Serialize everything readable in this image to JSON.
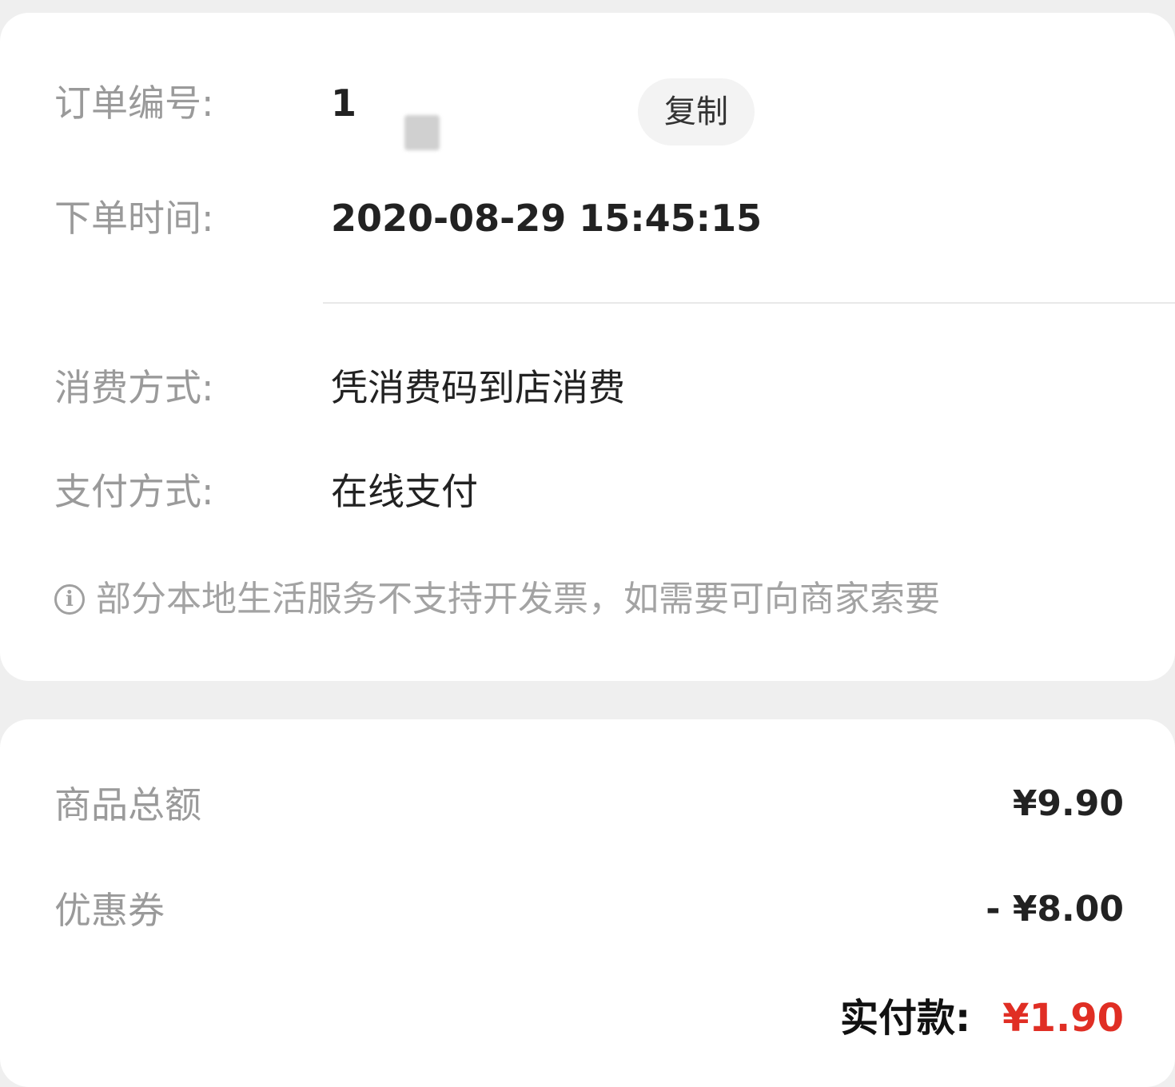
{
  "order": {
    "number_label": "订单编号:",
    "number_value": "1",
    "copy_label": "复制",
    "time_label": "下单时间:",
    "time_value": "2020-08-29 15:45:15",
    "consume_label": "消费方式:",
    "consume_value": "凭消费码到店消费",
    "pay_label": "支付方式:",
    "pay_value": "在线支付",
    "notice_icon": "i",
    "notice_text": "部分本地生活服务不支持开发票，如需要可向商家索要"
  },
  "amount": {
    "total_goods_label": "商品总额",
    "total_goods_value": "¥9.90",
    "coupon_label": "优惠券",
    "coupon_value": "- ¥8.00",
    "paid_label": "实付款:",
    "paid_value": "¥1.90"
  },
  "colors": {
    "accent_price": "#e02e24",
    "label_gray": "#9a9a9a",
    "background": "#efefef"
  }
}
